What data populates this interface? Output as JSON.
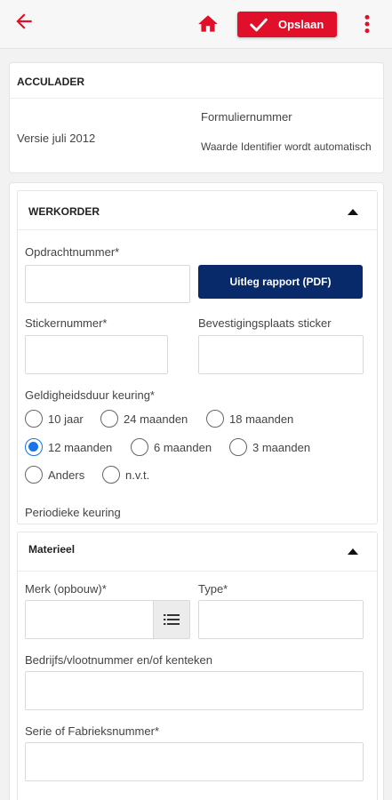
{
  "toolbar": {
    "back_icon": "arrow-left-icon",
    "home_icon": "home-icon",
    "save_label": "Opslaan",
    "more_icon": "more-vertical-icon",
    "accent_color": "#e0102a"
  },
  "form_header": {
    "title": "ACCULADER",
    "version": "Versie juli 2012",
    "form_number_label": "Formuliernummer",
    "form_number_value": "Waarde Identifier wordt automatisch"
  },
  "werkorder": {
    "title": "WERKORDER",
    "opdrachtnummer_label": "Opdrachtnummer*",
    "pdf_button_label": "Uitleg rapport (PDF)",
    "stickernummer_label": "Stickernummer*",
    "bevestigingsplaats_label": "Bevestigingsplaats sticker",
    "geldigheidsduur_label": "Geldigheidsduur keuring*",
    "options": [
      "10 jaar",
      "24 maanden",
      "18 maanden",
      "12 maanden",
      "6 maanden",
      "3 maanden",
      "Anders",
      "n.v.t."
    ],
    "selected_option": "12 maanden",
    "periodieke_label": "Periodieke keuring"
  },
  "materieel": {
    "title": "Materieel",
    "merk_label": "Merk (opbouw)*",
    "type_label": "Type*",
    "bedrijfs_label": "Bedrijfs/vlootnummer en/of kenteken",
    "serie_label": "Serie of Fabrieksnummer*"
  }
}
